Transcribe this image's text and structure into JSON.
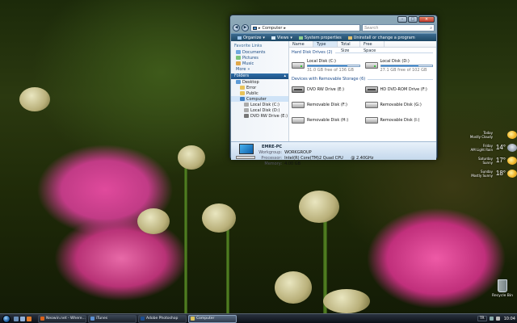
{
  "window": {
    "address": {
      "path_label": "Computer",
      "search_placeholder": "Search"
    },
    "toolbar": {
      "organize": "Organize",
      "views": "Views",
      "system_properties": "System properties",
      "uninstall": "Uninstall or change a program"
    },
    "nav": {
      "favorite_links_heading": "Favorite Links",
      "links": [
        {
          "label": "Documents",
          "icon": "documents-icon"
        },
        {
          "label": "Pictures",
          "icon": "pictures-icon"
        },
        {
          "label": "Music",
          "icon": "music-icon"
        },
        {
          "label": "More",
          "icon": "more-chevron-icon"
        }
      ],
      "folders_heading": "Folders",
      "tree": [
        "Desktop",
        "Error",
        "Public",
        "Computer",
        "Local Disk (C:)",
        "Local Disk (D:)",
        "DVD RW Drive (E:)"
      ]
    },
    "columns": [
      "Name",
      "Type",
      "Total Size",
      "Free Space"
    ],
    "hard_disk_group": "Hard Disk Drives (2)",
    "hard_disks": [
      {
        "name": "Local Disk (C:)",
        "free_text": "31.0 GB free of 136 GB",
        "used": 0.77
      },
      {
        "name": "Local Disk (D:)",
        "free_text": "27.1 GB free of 102 GB",
        "used": 0.73
      }
    ],
    "removable_group": "Devices with Removable Storage (6)",
    "removable": [
      {
        "name": "DVD RW Drive (E:)",
        "type": "optical"
      },
      {
        "name": "HD DVD-ROM Drive (F:)",
        "type": "optical"
      },
      {
        "name": "Removable Disk (F:)",
        "type": "disk"
      },
      {
        "name": "Removable Disk (G:)",
        "type": "disk"
      },
      {
        "name": "Removable Disk (H:)",
        "type": "disk"
      },
      {
        "name": "Removable Disk (I:)",
        "type": "disk"
      }
    ],
    "details": {
      "computer_name": "EMRE-PC",
      "workgroup_label": "Workgroup:",
      "workgroup": "WORKGROUP",
      "processor_label": "Processor:",
      "processor": "Intel(R) Core(TM)2 Quad CPU",
      "processor_speed": "@ 2.40GHz",
      "memory_label": "Memory:",
      "memory": "4.00 GB"
    }
  },
  "weather": [
    {
      "day": "Today",
      "desc": "Mostly Cloudy",
      "temp": "",
      "icon": "partly-cloudy-icon"
    },
    {
      "day": "Friday",
      "desc": "AM Light Rain",
      "temp": "14°",
      "icon": "rain-icon"
    },
    {
      "day": "Saturday",
      "desc": "Sunny",
      "temp": "17°",
      "icon": "sunny-icon"
    },
    {
      "day": "Sunday",
      "desc": "Mostly Sunny",
      "temp": "18°",
      "icon": "sunny-icon"
    }
  ],
  "desktop": {
    "recycle_bin_label": "Recycle Bin"
  },
  "taskbar": {
    "tasks": [
      {
        "label": "Neowin.net - Where...",
        "icon_color": "#d9621b"
      },
      {
        "label": "iTunes",
        "icon_color": "#5b8fd0"
      },
      {
        "label": "Adobe Photoshop",
        "icon_color": "#1d4e8f"
      },
      {
        "label": "Computer",
        "icon_color": "#d9c15a"
      }
    ],
    "language": "TR",
    "clock": "10:04"
  }
}
